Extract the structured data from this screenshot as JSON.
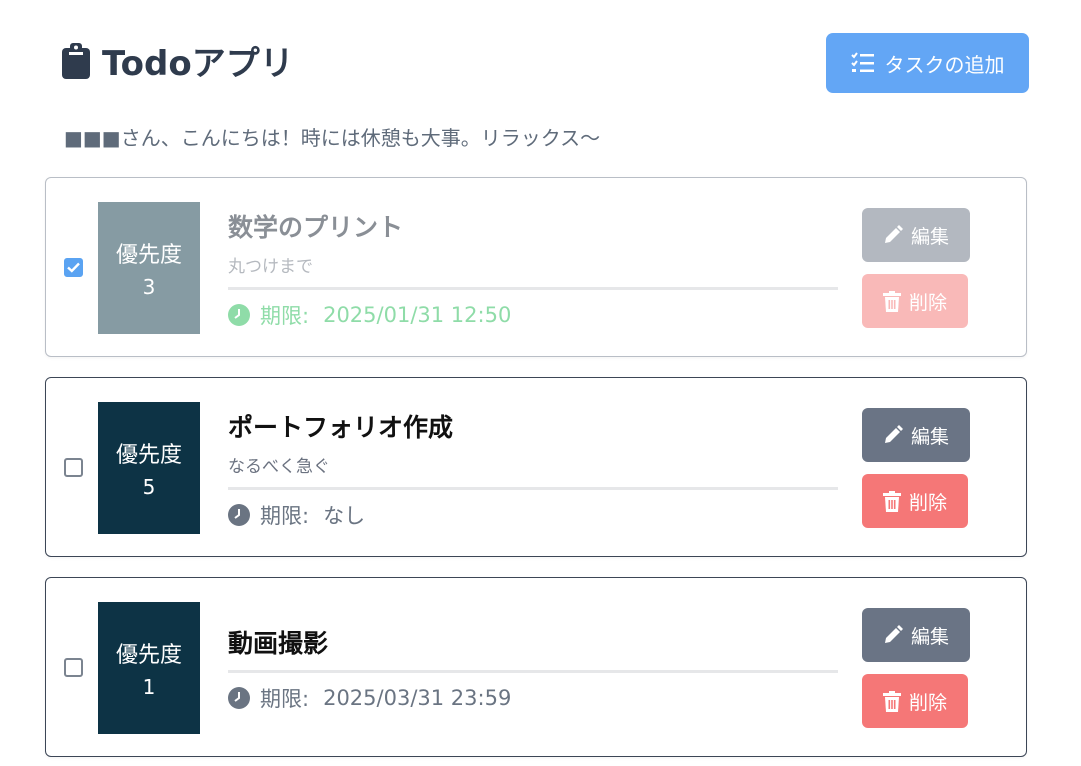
{
  "header": {
    "title": "Todoアプリ",
    "add_button_label": "タスクの追加"
  },
  "greeting": "■■■さん、こんにちは！時には休憩も大事。リラックス〜",
  "tasks": [
    {
      "checked": true,
      "priority_label": "優先度",
      "priority_value": "3",
      "title": "数学のプリント",
      "note": "丸つけまで",
      "deadline_label": "期限:",
      "deadline_value": "2025/01/31 12:50",
      "edit_label": "編集",
      "delete_label": "削除"
    },
    {
      "checked": false,
      "priority_label": "優先度",
      "priority_value": "5",
      "title": "ポートフォリオ作成",
      "note": "なるべく急ぐ",
      "deadline_label": "期限:",
      "deadline_value": "なし",
      "edit_label": "編集",
      "delete_label": "削除"
    },
    {
      "checked": false,
      "priority_label": "優先度",
      "priority_value": "1",
      "title": "動画撮影",
      "deadline_label": "期限:",
      "deadline_value": "2025/03/31 23:59",
      "edit_label": "編集",
      "delete_label": "削除"
    }
  ],
  "colors": {
    "add_button": "#63a6f5",
    "priority_bg": "#0d3345",
    "priority_bg_done": "#869ba3",
    "edit_button": "#6a7485",
    "delete_button": "#f57777",
    "deadline_done": "#8fdca8"
  },
  "icons": {
    "header": "clipboard-icon",
    "add_button": "checklist-icon",
    "deadline": "clock-icon",
    "edit": "pencil-icon",
    "delete": "trash-icon"
  }
}
